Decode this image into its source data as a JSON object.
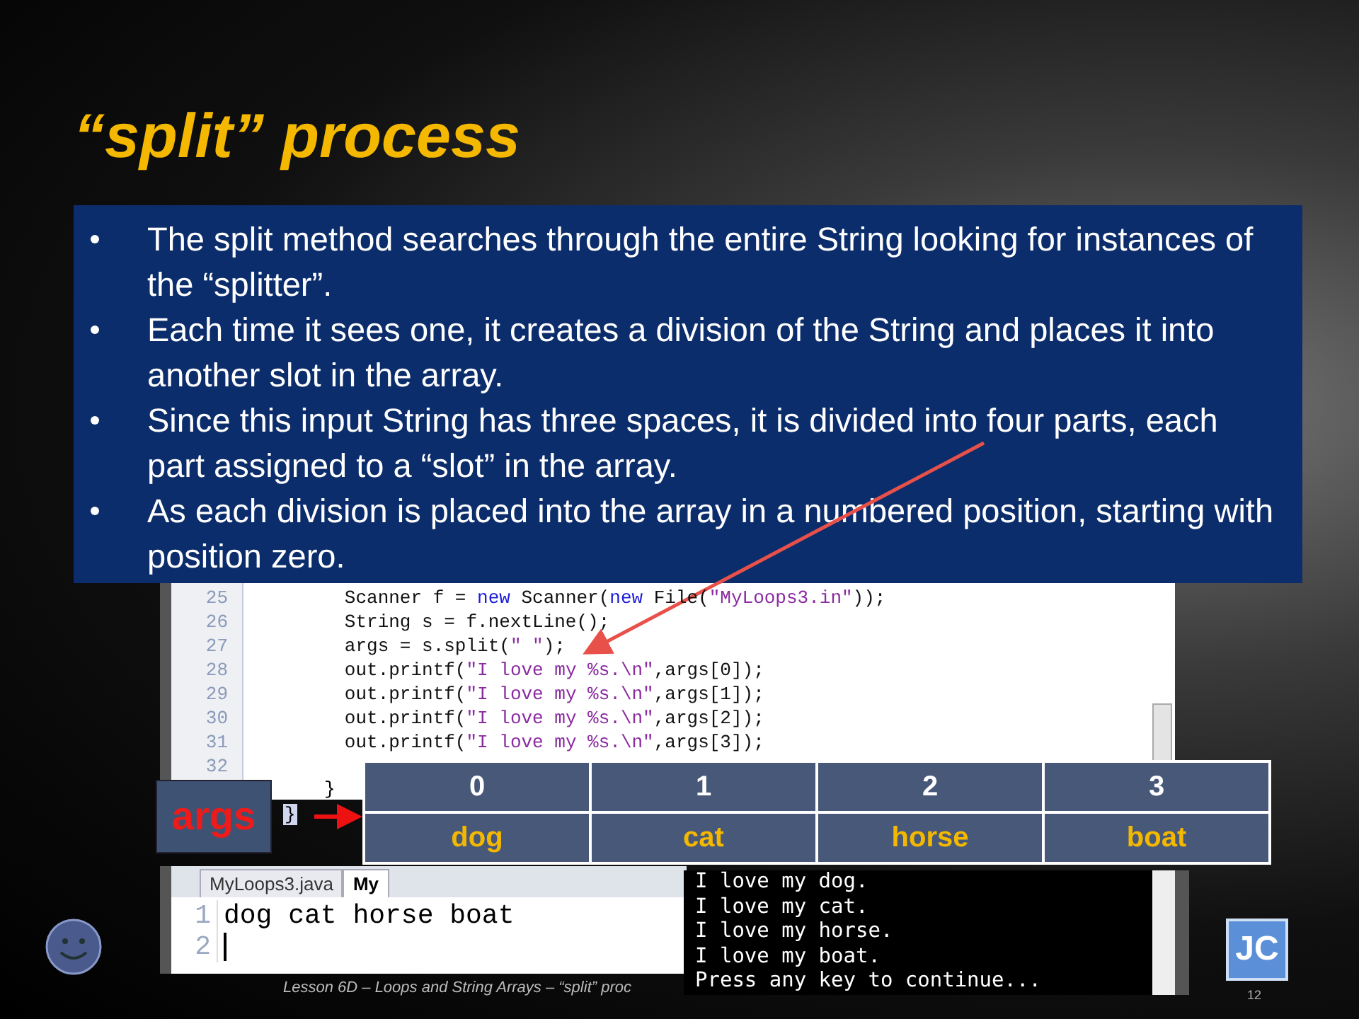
{
  "title": "“split” process",
  "bullets": [
    "The split method searches through the entire String looking for instances of the “splitter”.",
    "Each time it sees one, it creates a division of the String and places it into another slot in the array.",
    "Since this input String has three spaces, it is divided into four parts, each part assigned to a “slot” in the array.",
    "As each division is placed into the array in a numbered position, starting with position zero."
  ],
  "code": {
    "lines": [
      {
        "number": "25",
        "segments": [
          {
            "kind": "plain",
            "text": "        Scanner f = "
          },
          {
            "kind": "keyword",
            "text": "new"
          },
          {
            "kind": "plain",
            "text": " Scanner("
          },
          {
            "kind": "keyword",
            "text": "new"
          },
          {
            "kind": "plain",
            "text": " File("
          },
          {
            "kind": "string",
            "text": "\"MyLoops3.in\""
          },
          {
            "kind": "plain",
            "text": "));"
          }
        ]
      },
      {
        "number": "26",
        "segments": [
          {
            "kind": "plain",
            "text": "        String s = f.nextLine();"
          }
        ]
      },
      {
        "number": "27",
        "segments": [
          {
            "kind": "plain",
            "text": "        args = s.split("
          },
          {
            "kind": "string",
            "text": "\" \""
          },
          {
            "kind": "plain",
            "text": ");"
          }
        ]
      },
      {
        "number": "28",
        "segments": [
          {
            "kind": "plain",
            "text": "        out.printf("
          },
          {
            "kind": "string",
            "text": "\"I love my %s.\\n\""
          },
          {
            "kind": "plain",
            "text": ",args[0]);"
          }
        ]
      },
      {
        "number": "29",
        "segments": [
          {
            "kind": "plain",
            "text": "        out.printf("
          },
          {
            "kind": "string",
            "text": "\"I love my %s.\\n\""
          },
          {
            "kind": "plain",
            "text": ",args[1]);"
          }
        ]
      },
      {
        "number": "30",
        "segments": [
          {
            "kind": "plain",
            "text": "        out.printf("
          },
          {
            "kind": "string",
            "text": "\"I love my %s.\\n\""
          },
          {
            "kind": "plain",
            "text": ",args[2]);"
          }
        ]
      },
      {
        "number": "31",
        "segments": [
          {
            "kind": "plain",
            "text": "        out.printf("
          },
          {
            "kind": "string",
            "text": "\"I love my %s.\\n\""
          },
          {
            "kind": "plain",
            "text": ",args[3]);"
          }
        ]
      },
      {
        "number": "32"
      }
    ],
    "braces": [
      "}",
      "}"
    ]
  },
  "array": {
    "label": "args",
    "indices": [
      "0",
      "1",
      "2",
      "3"
    ],
    "values": [
      "dog",
      "cat",
      "horse",
      "boat"
    ]
  },
  "editor": {
    "tabs": [
      {
        "label": "MyLoops3.java",
        "selected": false
      },
      {
        "label": "My",
        "selected": true
      }
    ],
    "lines": [
      {
        "number": "1",
        "text": "dog cat horse boat"
      },
      {
        "number": "2"
      }
    ]
  },
  "console": [
    "I love my dog.",
    "I love my cat.",
    "I love my horse.",
    "I love my boat.",
    "Press any key to continue..."
  ],
  "footer": "Lesson 6D – Loops and String Arrays – “split” proc",
  "logo": "JC",
  "page_number": "12"
}
